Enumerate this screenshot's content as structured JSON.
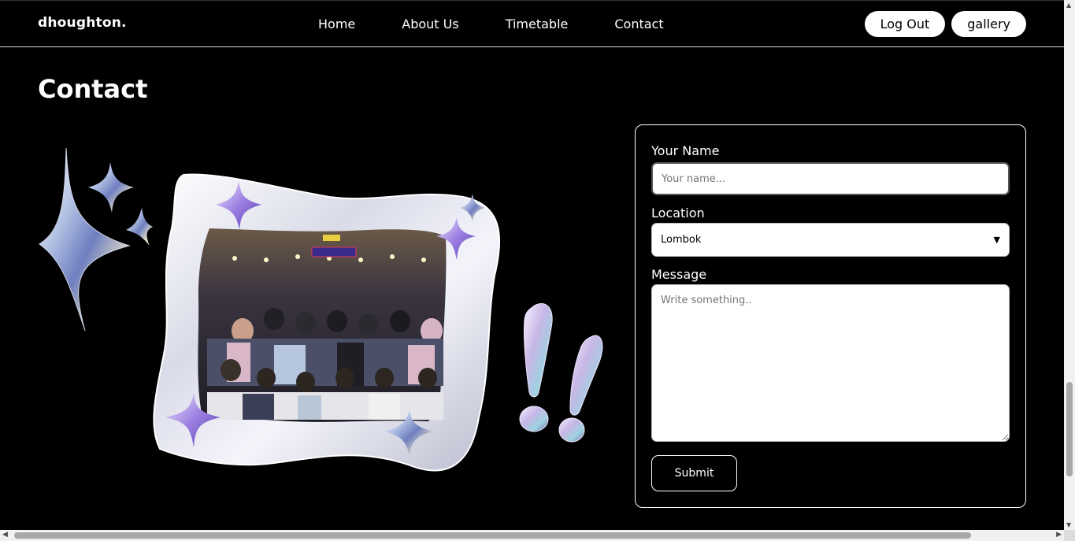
{
  "nav": {
    "brand": "dhoughton.",
    "links": [
      "Home",
      "About Us",
      "Timetable",
      "Contact"
    ],
    "actions": {
      "logout": "Log Out",
      "gallery": "gallery"
    }
  },
  "page": {
    "title": "Contact"
  },
  "form": {
    "name_label": "Your Name",
    "name_placeholder": "Your name...",
    "location_label": "Location",
    "location_value": "Lombok",
    "message_label": "Message",
    "message_placeholder": "Write something..",
    "submit_label": "Submit"
  },
  "colors": {
    "background": "#000000",
    "text": "#ffffff",
    "frame": "#e8e8f2",
    "star_purple": "#9b7fe0"
  },
  "icons": [
    "sparkle-star-icon",
    "exclamation-icon",
    "chevron-down-icon"
  ]
}
